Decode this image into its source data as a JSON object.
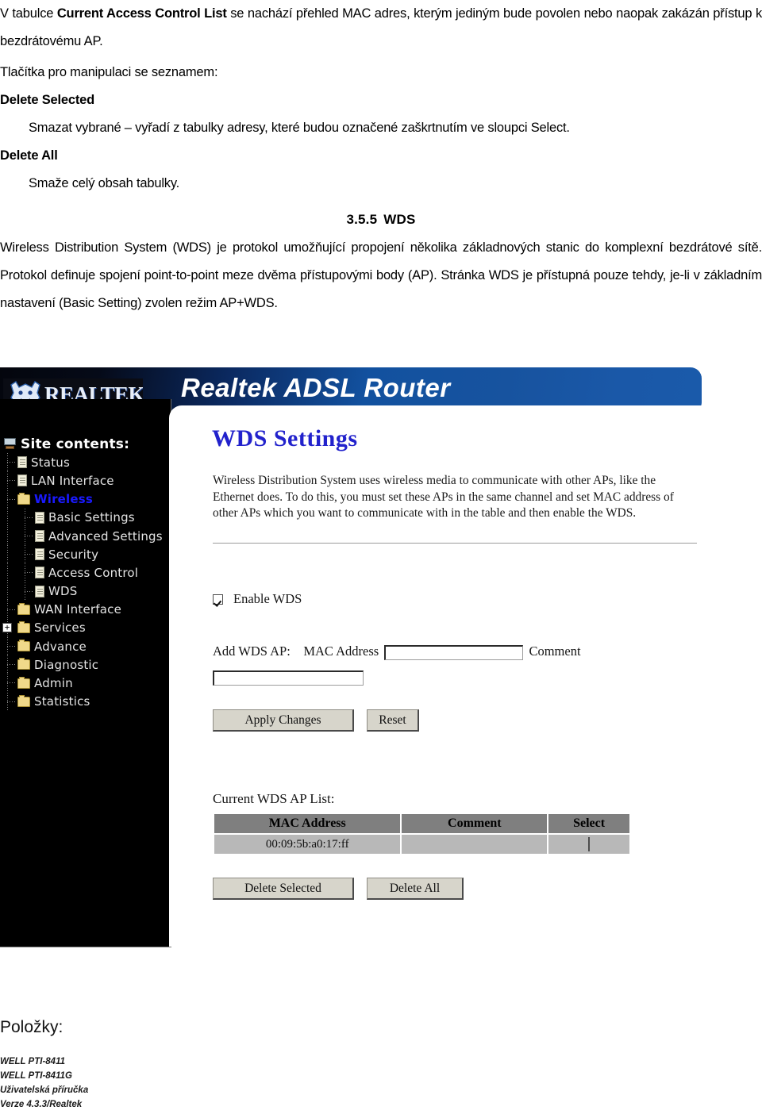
{
  "document": {
    "intro": {
      "prefix": "V tabulce ",
      "bold_term": "Current Access Control List",
      "suffix": " se nachází přehled MAC adres, kterým jediným bude povolen nebo naopak zakázán přístup k bezdrátovému AP."
    },
    "buttons_lead": "Tlačítka pro manipulaci se seznamem:",
    "items": [
      {
        "term": "Delete Selected",
        "desc": "Smazat vybrané – vyřadí z tabulky adresy, které budou označené zaškrtnutím ve sloupci Select."
      },
      {
        "term": "Delete All",
        "desc": "Smaže celý obsah tabulky."
      }
    ],
    "section": {
      "number": "3.5.5",
      "title": "WDS"
    },
    "section_body": "Wireless Distribution System (WDS) je protokol umožňující propojení několika základnových stanic do komplexní bezdrátové sítě. Protokol definuje spojení point-to-point meze dvěma přístupovými body (AP). Stránka WDS je přístupná pouze tehdy, je-li v základním nastavení (Basic Setting) zvolen režim AP+WDS."
  },
  "screenshot": {
    "brand": {
      "logo_word": "REALTEK",
      "title": "Realtek ADSL Router"
    },
    "sidebar": {
      "root_label": "Site contents:",
      "items": [
        {
          "label": "Status",
          "icon": "page-icon",
          "level": 1,
          "active": false,
          "expander": ""
        },
        {
          "label": "LAN Interface",
          "icon": "page-icon",
          "level": 1,
          "active": false,
          "expander": ""
        },
        {
          "label": "Wireless",
          "icon": "folder-icon",
          "level": 1,
          "active": true,
          "expander": ""
        },
        {
          "label": "Basic Settings",
          "icon": "page-icon",
          "level": 2,
          "active": false,
          "expander": ""
        },
        {
          "label": "Advanced Settings",
          "icon": "page-icon",
          "level": 2,
          "active": false,
          "expander": ""
        },
        {
          "label": "Security",
          "icon": "page-icon",
          "level": 2,
          "active": false,
          "expander": ""
        },
        {
          "label": "Access Control",
          "icon": "page-icon",
          "level": 2,
          "active": false,
          "expander": ""
        },
        {
          "label": "WDS",
          "icon": "page-icon",
          "level": 2,
          "active": false,
          "expander": ""
        },
        {
          "label": "WAN Interface",
          "icon": "folder-icon",
          "level": 1,
          "active": false,
          "expander": ""
        },
        {
          "label": "Services",
          "icon": "folder-icon",
          "level": 1,
          "active": false,
          "expander": "+"
        },
        {
          "label": "Advance",
          "icon": "folder-icon",
          "level": 1,
          "active": false,
          "expander": ""
        },
        {
          "label": "Diagnostic",
          "icon": "folder-icon",
          "level": 1,
          "active": false,
          "expander": ""
        },
        {
          "label": "Admin",
          "icon": "folder-icon",
          "level": 1,
          "active": false,
          "expander": ""
        },
        {
          "label": "Statistics",
          "icon": "folder-icon",
          "level": 1,
          "active": false,
          "expander": ""
        }
      ]
    },
    "main": {
      "page_title": "WDS Settings",
      "description": "Wireless Distribution System uses wireless media to communicate with other APs, like the Ethernet does. To do this, you must set these APs in the same channel and set MAC address of other APs which you want to communicate with in the table and then enable the WDS.",
      "enable_wds": {
        "label": "Enable WDS",
        "checked": true
      },
      "add_ap": {
        "label": "Add WDS AP:",
        "mac_label": "MAC Address",
        "mac_value": "",
        "comment_label": "Comment",
        "comment_value": ""
      },
      "buttons": {
        "apply": "Apply Changes",
        "reset": "Reset",
        "delete_selected": "Delete Selected",
        "delete_all": "Delete All"
      },
      "list": {
        "label": "Current WDS AP List:",
        "columns": [
          "MAC Address",
          "Comment",
          "Select"
        ],
        "rows": [
          {
            "mac": "00:09:5b:a0:17:ff",
            "comment": "",
            "selected": false
          }
        ]
      }
    },
    "colors": {
      "header_dark": "#04060d",
      "header_blue": "#1a5aaa",
      "title_blue": "#2222cc",
      "active_item": "#1a1aff",
      "table_header": "#7f7f7f",
      "table_row": "#b8b8b8",
      "button_face": "#d7d5cb"
    }
  },
  "footer": {
    "heading": "Položky:",
    "lines": [
      "WELL PTI-8411",
      "WELL PTI-8411G",
      "Uživatelská příručka",
      "Verze 4.3.3/Realtek"
    ]
  }
}
